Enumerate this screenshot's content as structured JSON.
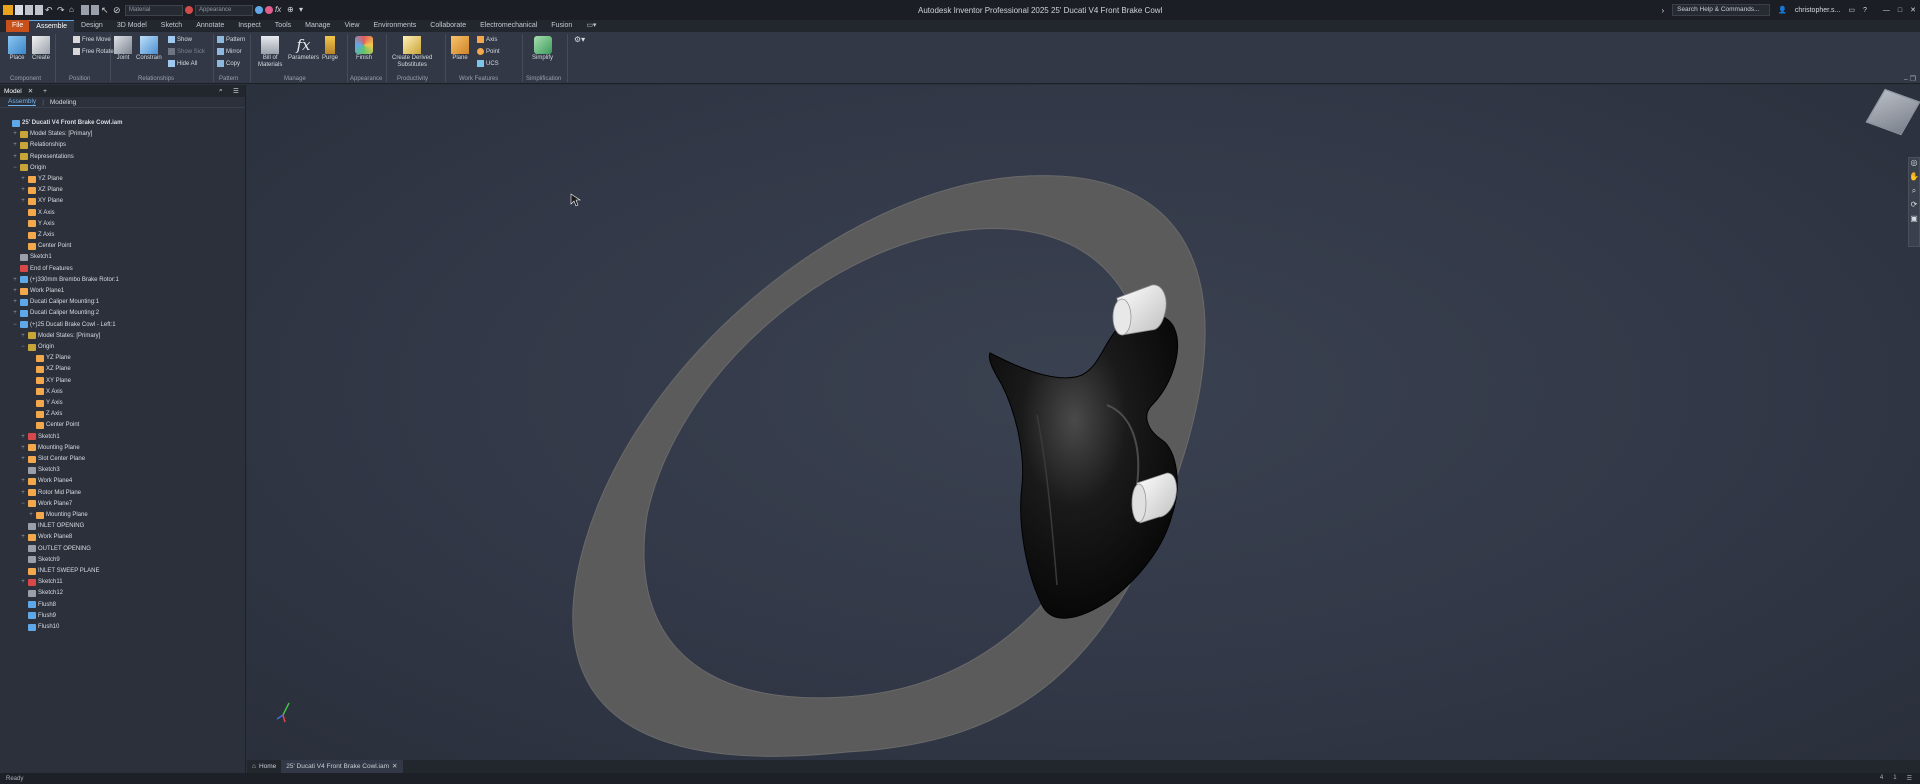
{
  "app": {
    "title": "Autodesk Inventor Professional 2025   25' Ducati V4 Front Brake Cowl",
    "search_placeholder": "Search Help & Commands...",
    "user": "christopher.s...",
    "material_select": "Material",
    "appearance_select": "Appearance"
  },
  "tabs": [
    "File",
    "Assemble",
    "Design",
    "3D Model",
    "Sketch",
    "Annotate",
    "Inspect",
    "Tools",
    "Manage",
    "View",
    "Environments",
    "Collaborate",
    "Electromechanical",
    "Fusion"
  ],
  "ribbon": {
    "place": "Place",
    "create": "Create",
    "free_move": "Free Move",
    "free_rotate": "Free Rotate",
    "joint": "Joint",
    "constrain": "Constrain",
    "show": "Show",
    "show_sick": "Show Sick",
    "hide_all": "Hide All",
    "pattern": "Pattern",
    "mirror": "Mirror",
    "copy": "Copy",
    "bom_line1": "Bill of",
    "bom_line2": "Materials",
    "parameters": "Parameters",
    "purge": "Purge",
    "finish": "Finish",
    "cds_line1": "Create Derived",
    "cds_line2": "Substitutes",
    "plane": "Plane",
    "axis": "Axis",
    "point": "Point",
    "ucs": "UCS",
    "simplify": "Simplify",
    "groups": {
      "component": "Component",
      "position": "Position",
      "relationships": "Relationships",
      "pattern": "Pattern",
      "manage": "Manage",
      "appearance": "Appearance",
      "productivity": "Productivity",
      "work_features": "Work Features",
      "simplification": "Simplification"
    }
  },
  "browser": {
    "tab_label": "Model",
    "sub_assembly": "Assembly",
    "sub_modeling": "Modeling",
    "nodes": [
      "25' Ducati V4 Front Brake Cowl.iam",
      "Model States: [Primary]",
      "Relationships",
      "Representations",
      "Origin",
      "YZ Plane",
      "XZ Plane",
      "XY Plane",
      "X Axis",
      "Y Axis",
      "Z Axis",
      "Center Point",
      "Sketch1",
      "End of Features",
      "(+)330mm Brembo Brake Rotor:1",
      "Work Plane1",
      "Ducati Caliper Mounting:1",
      "Ducati Caliper Mounting:2",
      "(+)25 Ducati Brake Cowl - Left:1",
      "Model States: [Primary]",
      "Origin",
      "YZ Plane",
      "XZ Plane",
      "XY Plane",
      "X Axis",
      "Y Axis",
      "Z Axis",
      "Center Point",
      "Sketch1",
      "Mounting Plane",
      "Slot Center Plane",
      "Sketch3",
      "Work Plane4",
      "Rotor Mid Plane",
      "Work Plane7",
      "Mounting Plane",
      "INLET OPENING",
      "Work Plane8",
      "OUTLET OPENING",
      "Sketch9",
      "INLET SWEEP PLANE",
      "Sketch11",
      "Sketch12",
      "Flush8",
      "Flush9",
      "Flush10"
    ]
  },
  "doc_tabs": {
    "home": "Home",
    "active": "25' Ducati V4 Front Brake Cowl.iam"
  },
  "status": {
    "left": "Ready",
    "right1": "4",
    "right2": "1"
  },
  "colors": {
    "accent": "#c8501a",
    "selection": "#6fb3ee",
    "viewport_bg": "#323847",
    "rotor": "#5b5b5b"
  }
}
